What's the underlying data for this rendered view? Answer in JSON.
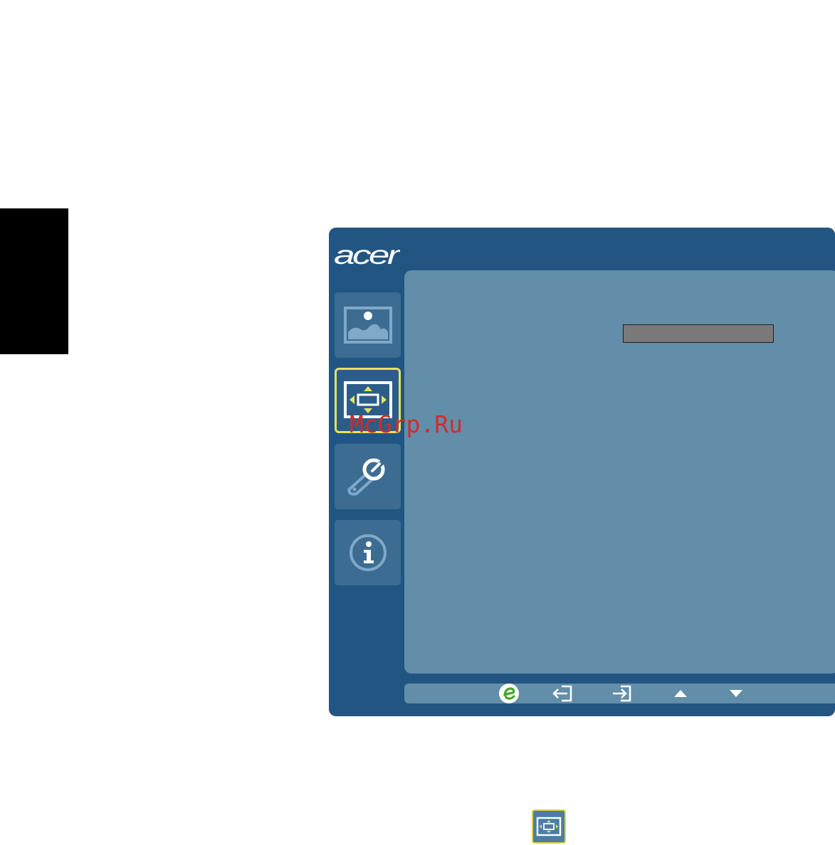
{
  "osd": {
    "brand": "acer",
    "nav": [
      {
        "name": "picture-tab",
        "icon": "picture-icon"
      },
      {
        "name": "osd-tab",
        "icon": "screen-position-icon",
        "active": true
      },
      {
        "name": "settings-tab",
        "icon": "wrench-icon"
      },
      {
        "name": "information-tab",
        "icon": "info-icon"
      }
    ],
    "buttons": [
      {
        "name": "empowering-key",
        "icon": "acer-e-icon"
      },
      {
        "name": "exit-button",
        "icon": "exit-icon"
      },
      {
        "name": "enter-button",
        "icon": "enter-icon"
      },
      {
        "name": "up-button",
        "icon": "arrow-up-icon"
      },
      {
        "name": "down-button",
        "icon": "arrow-down-icon"
      }
    ],
    "colors": {
      "frame": "#235582",
      "panel": "#628ea9",
      "highlight": "#e6e35c",
      "value_bar": "#7a7878"
    }
  },
  "watermark": "McGrp.Ru"
}
